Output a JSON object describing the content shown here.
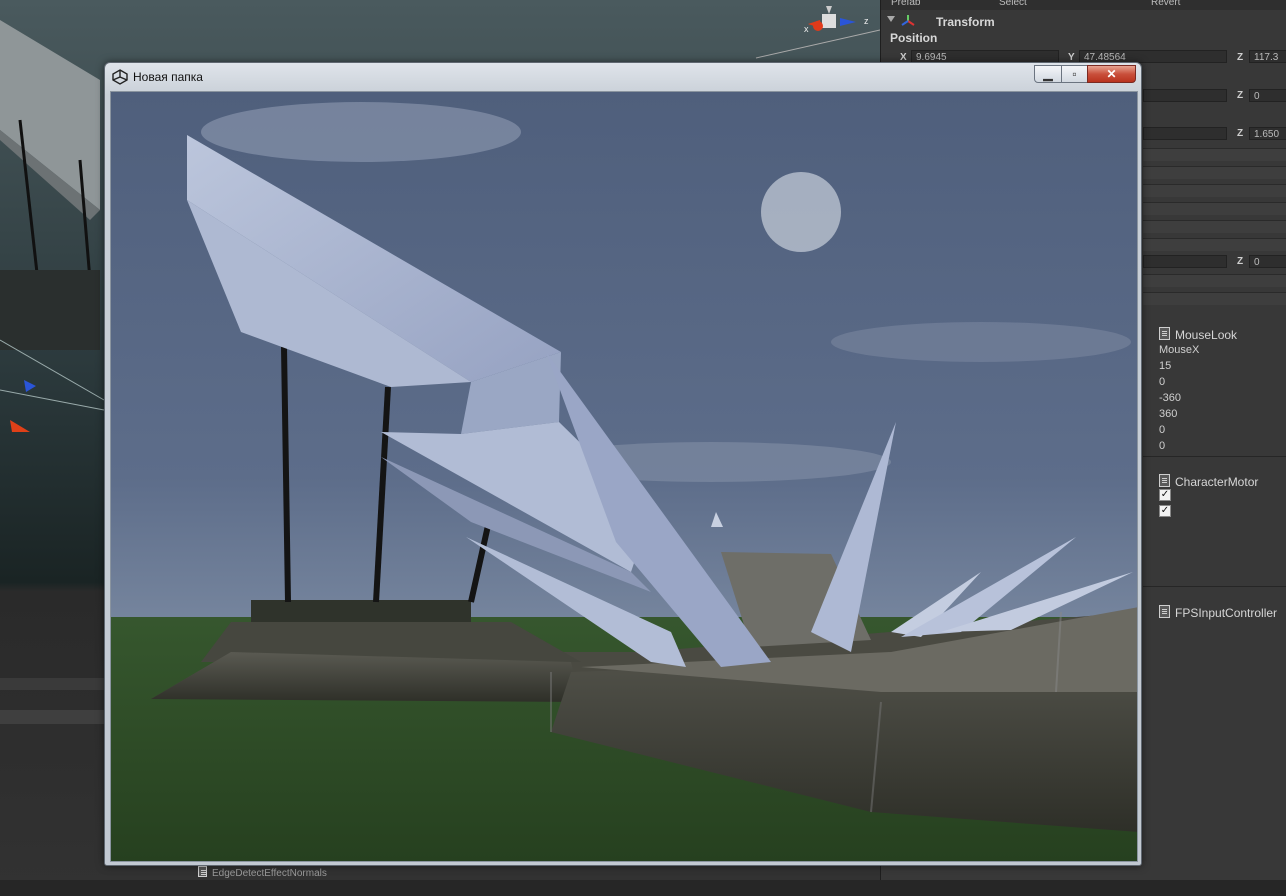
{
  "window": {
    "title": "Новая папка",
    "icon": "unity-icon",
    "controls": [
      "minimize-icon",
      "maximize-icon",
      "close-icon"
    ]
  },
  "inspector": {
    "prefab_label": "Prefab",
    "prefab_select": "Select",
    "prefab_revert": "Revert",
    "transform_title": "Transform",
    "position_label": "Position",
    "position": {
      "x": "9.6945",
      "y": "47.48564",
      "z": "117.3"
    },
    "rotation": {
      "z": "0"
    },
    "scale": {
      "z": "1.650"
    },
    "extra": {
      "z": "0"
    },
    "mouselook": {
      "title": "MouseLook",
      "values": [
        "MouseX",
        "15",
        "0",
        "-360",
        "360",
        "0",
        "0"
      ]
    },
    "charactermotor": {
      "title": "CharacterMotor",
      "checks": [
        true,
        true
      ]
    },
    "fpsinput": {
      "title": "FPSInputController"
    }
  },
  "statusbar": {
    "item": "EdgeDetectEffectNormals"
  },
  "colors": {
    "sky": "#5a6a86",
    "grass": "#2f4d2a",
    "close_red": "#c9503c"
  }
}
